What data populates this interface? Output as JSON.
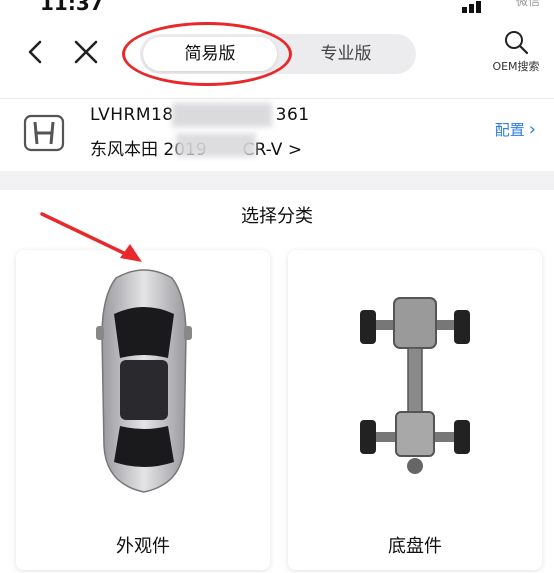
{
  "status_bar": {
    "time": "11:37",
    "battery_text": "微信"
  },
  "nav": {
    "segments": [
      {
        "label": "简易版",
        "selected": true
      },
      {
        "label": "专业版",
        "selected": false
      }
    ],
    "oem_search_label": "OEM搜索"
  },
  "vehicle": {
    "vin": "LVHRM18",
    "vin_tail": "361",
    "model": "东风本田 2019",
    "model_tail": "CR-V >",
    "config_label": "配置"
  },
  "categories": {
    "title": "选择分类",
    "items": [
      {
        "label": "外观件"
      },
      {
        "label": "底盘件"
      }
    ]
  },
  "colors": {
    "accent": "#2f7ee6",
    "annotation": "#e8292b"
  }
}
